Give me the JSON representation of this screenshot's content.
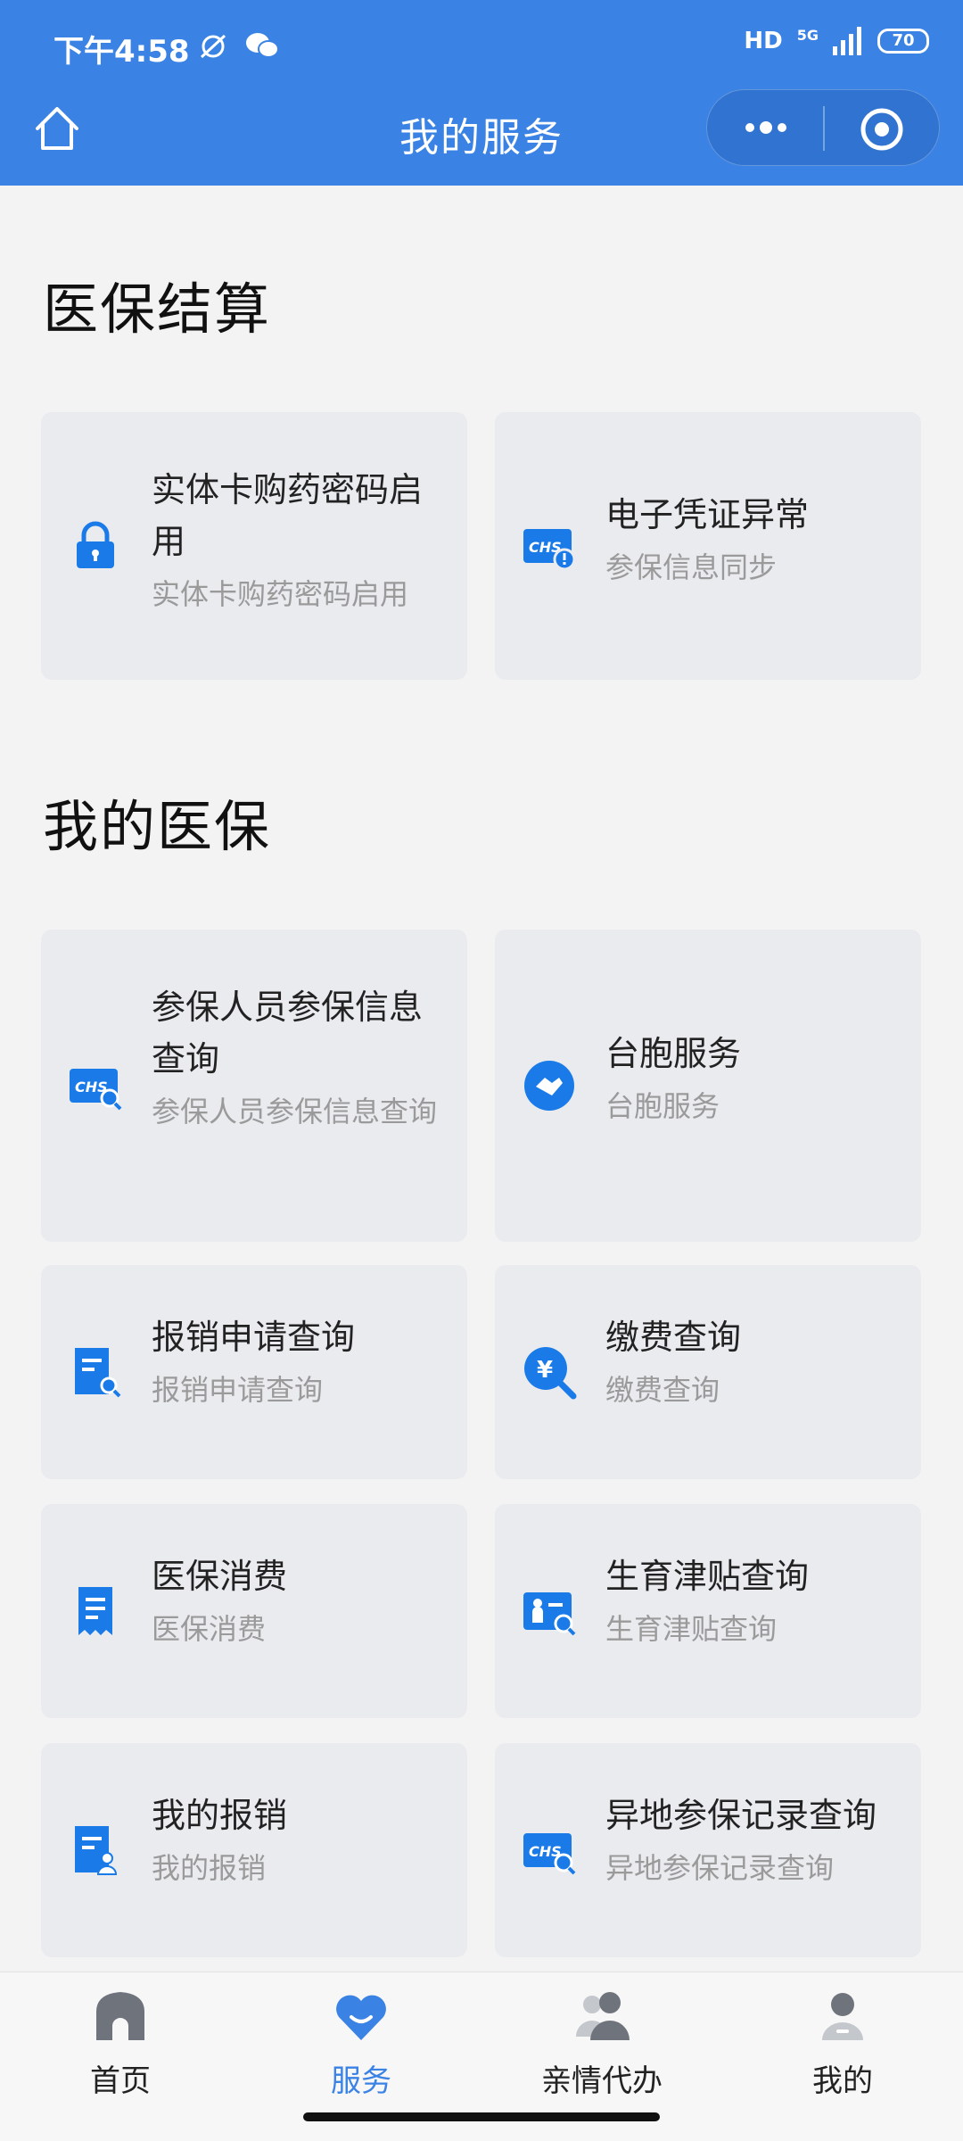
{
  "status_bar": {
    "time": "下午4:58",
    "hd": "HD",
    "network": "5G",
    "battery": "70"
  },
  "nav": {
    "title": "我的服务"
  },
  "sections": [
    {
      "title": "医保结算",
      "cards": [
        {
          "title": "实体卡购药密码启用",
          "subtitle": "实体卡购药密码启用",
          "icon": "lock-icon"
        },
        {
          "title": "电子凭证异常",
          "subtitle": "参保信息同步",
          "icon": "chs-alert-icon"
        }
      ]
    },
    {
      "title": "我的医保",
      "cards": [
        {
          "title": "参保人员参保信息查询",
          "subtitle": "参保人员参保信息查询",
          "icon": "chs-search-icon"
        },
        {
          "title": "台胞服务",
          "subtitle": "台胞服务",
          "icon": "handshake-icon"
        },
        {
          "title": "报销申请查询",
          "subtitle": "报销申请查询",
          "icon": "document-search-icon"
        },
        {
          "title": "缴费查询",
          "subtitle": "缴费查询",
          "icon": "yuan-search-icon"
        },
        {
          "title": "医保消费",
          "subtitle": "医保消费",
          "icon": "receipt-icon"
        },
        {
          "title": "生育津贴查询",
          "subtitle": "生育津贴查询",
          "icon": "maternity-search-icon"
        },
        {
          "title": "我的报销",
          "subtitle": "我的报销",
          "icon": "document-user-icon"
        },
        {
          "title": "异地参保记录查询",
          "subtitle": "异地参保记录查询",
          "icon": "chs-search-icon"
        }
      ]
    }
  ],
  "tabbar": [
    {
      "label": "首页",
      "icon": "home-icon",
      "active": false
    },
    {
      "label": "服务",
      "icon": "heart-service-icon",
      "active": true
    },
    {
      "label": "亲情代办",
      "icon": "family-icon",
      "active": false
    },
    {
      "label": "我的",
      "icon": "user-icon",
      "active": false
    }
  ],
  "colors": {
    "primary": "#3a82e4",
    "icon_blue": "#1a7be8",
    "card_bg": "#e9ebef",
    "page_bg": "#f3f3f4"
  }
}
